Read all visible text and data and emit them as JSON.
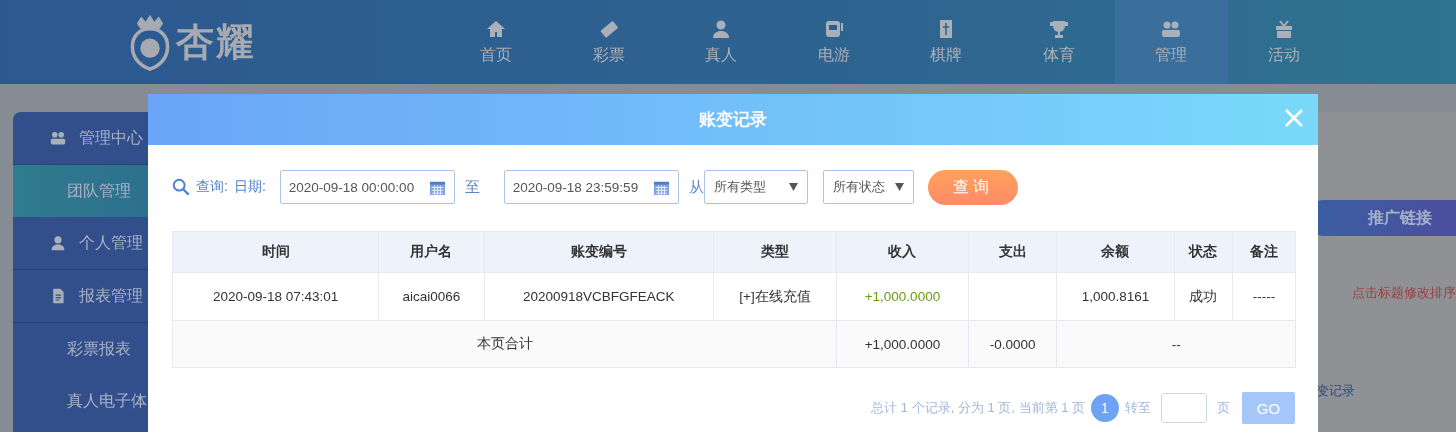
{
  "header": {
    "logo": "杏耀",
    "nav": [
      {
        "label": "首页",
        "selected": false
      },
      {
        "label": "彩票",
        "selected": false
      },
      {
        "label": "真人",
        "selected": false
      },
      {
        "label": "电游",
        "selected": false
      },
      {
        "label": "棋牌",
        "selected": false
      },
      {
        "label": "体育",
        "selected": false
      },
      {
        "label": "管理",
        "selected": true
      },
      {
        "label": "活动",
        "selected": false
      }
    ]
  },
  "sidebar": {
    "items": [
      {
        "label": "管理中心",
        "kind": "section",
        "selected": false
      },
      {
        "label": "团队管理",
        "kind": "sub",
        "selected": true
      },
      {
        "label": "个人管理",
        "kind": "section",
        "selected": false
      },
      {
        "label": "报表管理",
        "kind": "section",
        "selected": false
      },
      {
        "label": "彩票报表",
        "kind": "sub",
        "selected": false
      },
      {
        "label": "真人电子体",
        "kind": "sub",
        "selected": false
      }
    ]
  },
  "right_panel": {
    "promo_button": "推广链接",
    "hint": "点击标题修改排序",
    "link": "变记录"
  },
  "modal": {
    "title": "账变记录",
    "filter": {
      "query_label": "查询:",
      "date_label": "日期:",
      "start": "2020-09-18 00:00:00",
      "to": "至",
      "end": "2020-09-18 23:59:59",
      "from": "从",
      "type_select": "所有类型",
      "status_select": "所有状态",
      "button": "查询"
    },
    "table": {
      "columns": [
        "时间",
        "用户名",
        "账变编号",
        "类型",
        "收入",
        "支出",
        "余额",
        "状态",
        "备注"
      ],
      "rows": [
        [
          "2020-09-18 07:43:01",
          "aicai0066",
          "20200918VCBFGFEACK",
          "[+]在线充值",
          "+1,000.0000",
          "",
          "1,000.8161",
          "成功",
          "-----"
        ]
      ],
      "summary": {
        "label": "本页合计",
        "income": "+1,000.0000",
        "expense": "-0.0000",
        "rest": "--"
      }
    },
    "pagination": {
      "info": "总计 1 个记录, 分为 1 页, 当前第 1 页",
      "current": "1",
      "goto": "转至",
      "page_unit": "页",
      "go": "GO"
    }
  }
}
